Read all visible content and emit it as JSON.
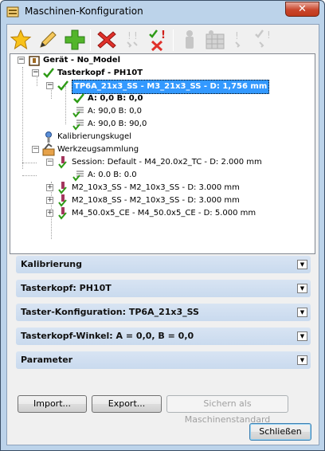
{
  "window": {
    "title": "Maschinen-Konfiguration",
    "close_label": "✕"
  },
  "toolbar": {
    "buttons": [
      {
        "icon": "star-icon"
      },
      {
        "icon": "pencil-icon"
      },
      {
        "icon": "add-icon"
      },
      {
        "icon": "delete-icon"
      },
      {
        "icon": "warning-icon"
      },
      {
        "icon": "check-delete-icon"
      },
      {
        "icon": "probe-icon"
      },
      {
        "icon": "rack-icon"
      },
      {
        "icon": "warning-icon"
      },
      {
        "icon": "check-warning-icon"
      }
    ]
  },
  "tree": {
    "nodes": [
      {
        "label": "Gerät - No_Model",
        "bold": true
      },
      {
        "label": "Tasterkopf - PH10T",
        "bold": true
      },
      {
        "label": "TP6A_21x3_SS - M3_21x3_SS - D: 1,756 mm",
        "bold": true,
        "selected": true
      },
      {
        "label": "A: 0,0 B: 0,0",
        "bold": true
      },
      {
        "label": "A: 90,0 B: 0,0",
        "bold": false
      },
      {
        "label": "A: 90,0 B: 90,0",
        "bold": false
      },
      {
        "label": "Kalibrierungskugel",
        "bold": false
      },
      {
        "label": "Werkzeugsammlung",
        "bold": false
      },
      {
        "label": "Session: Default - M4_20.0x2_TC - D: 2.000 mm",
        "bold": false
      },
      {
        "label": "A: 0.0 B: 0.0",
        "bold": false
      },
      {
        "label": "M2_10x3_SS - M2_10x3_SS - D: 3.000 mm",
        "bold": false
      },
      {
        "label": "M2_10x8_SS - M2_10x3_SS - D: 3.000 mm",
        "bold": false
      },
      {
        "label": "M4_50.0x5_CE - M4_50.0x5_CE - D: 5.000 mm",
        "bold": false
      }
    ]
  },
  "panels": [
    {
      "label": "Kalibrierung"
    },
    {
      "label": "Tasterkopf: PH10T"
    },
    {
      "label": "Taster-Konfiguration: TP6A_21x3_SS"
    },
    {
      "label": "Tasterkopf-Winkel: A = 0,0, B = 0,0"
    },
    {
      "label": "Parameter"
    }
  ],
  "buttons": {
    "import": "Import...",
    "export": "Export...",
    "save_default": "Sichern als Maschinenstandard",
    "close": "Schließen"
  },
  "colors": {
    "selection": "#3399ff",
    "panel": "#c9daee",
    "accent_green": "#2e9b16",
    "accent_red": "#d0201a"
  }
}
